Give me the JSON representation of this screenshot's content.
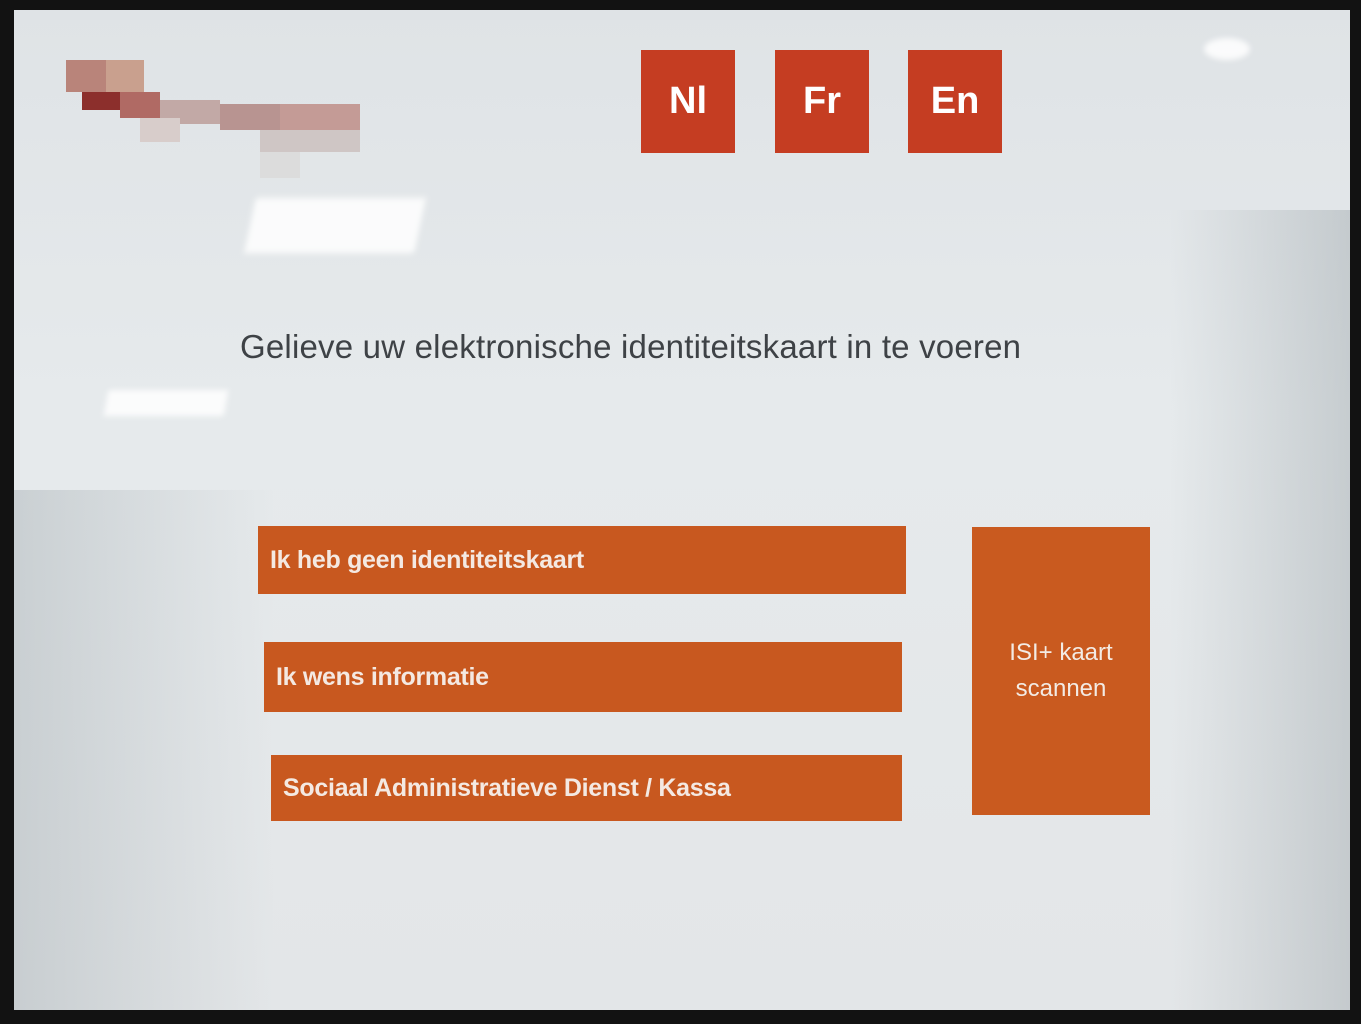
{
  "languages": [
    {
      "label": "Nl"
    },
    {
      "label": "Fr"
    },
    {
      "label": "En"
    }
  ],
  "prompt": "Gelieve uw elektronische identiteitskaart in te voeren",
  "options": [
    {
      "label": "Ik heb geen identiteitskaart"
    },
    {
      "label": "Ik wens informatie"
    },
    {
      "label": "Sociaal Administratieve Dienst / Kassa"
    }
  ],
  "scan_button": {
    "label": "ISI+ kaart scannen"
  },
  "colors": {
    "language_button": "#c53d22",
    "option_button": "#c8581f",
    "screen_background": "#e3e6e8",
    "prompt_text": "#3e4246"
  }
}
